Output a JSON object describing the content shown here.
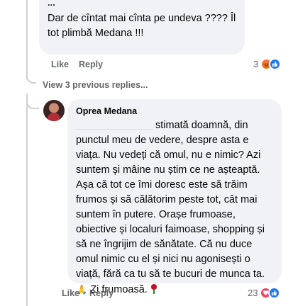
{
  "comment1": {
    "author_partial": "...",
    "text": "Dar de cîntat mai cînta pe undeva ???? Îl tot plimbă Medana !!!",
    "actions": {
      "like": "Like",
      "reply": "Reply"
    },
    "reaction_count": "3",
    "reaction_icons": [
      "angry-icon",
      "like-icon"
    ]
  },
  "view_replies": "View 3 previous replies...",
  "comment2": {
    "author": "Oprea Medana",
    "text_main": "stimată doamnă, din punctul meu de vedere, despre asta e viața. Nu vedeți că omul, nu e nimic? Azi suntem și mâine nu știm ce ne așteaptă. Așa că tot ce îmi doresc este să trăim frumos și să călătorim peste tot, cât mai suntem în putere. Orașe frumoase, obiective și localuri faimoase, shopping și să ne îngrijim de sănătate. Că nu duce omul nimic cu el și nici nu agonisești o viață, fără ca tu să te bucuri de munca ta.",
    "emoji_hands": "🙏",
    "text_end": "Zi frumoasă.",
    "actions": {
      "like": "Like",
      "reply": "Reply"
    },
    "reaction_count": "23",
    "reaction_icons": [
      "love-icon",
      "like-icon"
    ]
  },
  "colors": {
    "bubble": "#f0f2f5",
    "meta": "#65676b",
    "like_blue": "#1877f2",
    "love_red": "#f33e58"
  }
}
